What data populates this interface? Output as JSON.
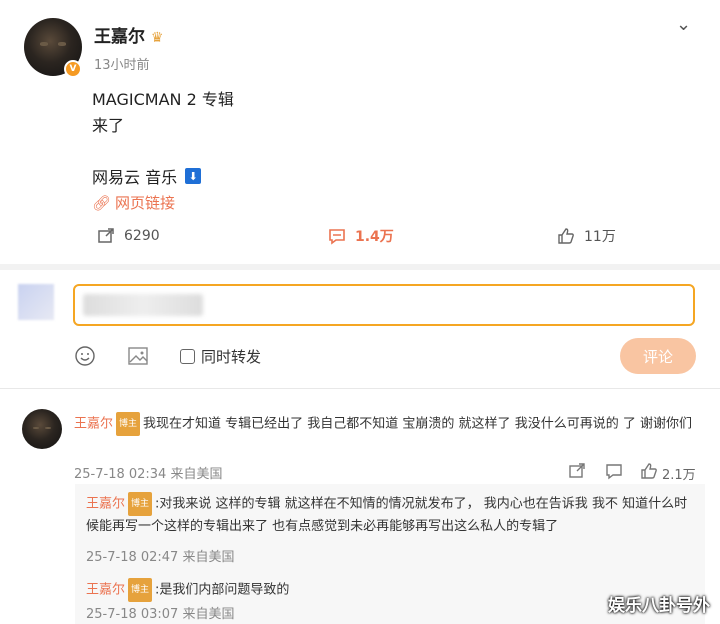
{
  "post": {
    "author": "王嘉尔",
    "time": "13小时前",
    "lines": [
      "MAGICMAN 2 专辑",
      "来了"
    ],
    "music_line": "网易云 音乐",
    "link": "网页链接",
    "actions": {
      "repost": "6290",
      "comment": "1.4万",
      "like": "11万"
    }
  },
  "composer": {
    "emoji_label": "",
    "sync_label": "同时转发",
    "submit_label": "评论"
  },
  "comment": {
    "author": "王嘉尔",
    "text": "我现在才知道 专辑已经出了 我自己都不知道 宝崩溃的 就这样了 我没什么可再说的 了 谢谢你们",
    "time": "25-7-18 02:34 来自美国",
    "like_count": "2.1万"
  },
  "replies": [
    {
      "author": "王嘉尔",
      "text": ":对我来说 这样的专辑 就这样在不知情的情况就发布了， 我内心也在告诉我 我不 知道什么时候能再写一个这样的专辑出来了 也有点感觉到未必再能够再写出这么私人的专辑了",
      "time": "25-7-18 02:47 来自美国"
    },
    {
      "author": "王嘉尔",
      "text": ":是我们内部问题导致的",
      "time": "25-7-18 03:07 来自美国"
    }
  ],
  "watermark": "娱乐八卦号外",
  "colors": {
    "accent": "#eb7350",
    "gold": "#e6a23c",
    "input_border": "#f5a623"
  }
}
